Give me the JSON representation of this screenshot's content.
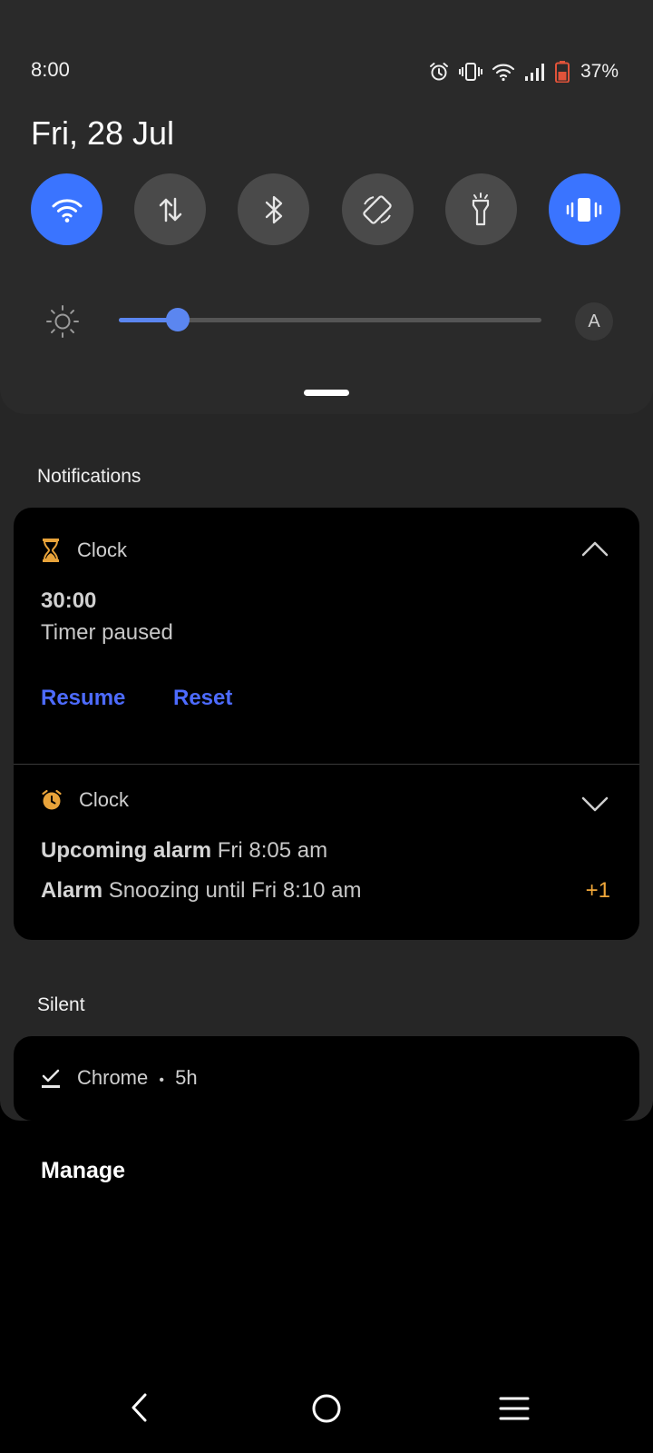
{
  "status_bar": {
    "time": "8:00",
    "battery": "37%",
    "icons": [
      "alarm-icon",
      "vibrate-icon",
      "wifi-icon",
      "signal-icon",
      "battery-icon"
    ]
  },
  "date": "Fri, 28 Jul",
  "quick_tiles": [
    {
      "name": "wifi",
      "icon": "wifi-icon",
      "active": true
    },
    {
      "name": "mobile-data",
      "icon": "data-arrows-icon",
      "active": false
    },
    {
      "name": "bluetooth",
      "icon": "bluetooth-icon",
      "active": false
    },
    {
      "name": "auto-rotate",
      "icon": "rotate-icon",
      "active": false
    },
    {
      "name": "flashlight",
      "icon": "flashlight-icon",
      "active": false
    },
    {
      "name": "vibrate",
      "icon": "vibrate-icon",
      "active": true
    }
  ],
  "brightness": {
    "level": 0.14,
    "auto_label": "A"
  },
  "sections": {
    "notifications": "Notifications",
    "silent": "Silent"
  },
  "timer_notification": {
    "app": "Clock",
    "title": "30:00",
    "text": "Timer paused",
    "actions": [
      "Resume",
      "Reset"
    ]
  },
  "alarm_notification": {
    "app": "Clock",
    "lines": [
      {
        "label": "Upcoming alarm",
        "text": "Fri 8:05 am"
      },
      {
        "label": "Alarm",
        "text": "Snoozing until Fri 8:10 am"
      }
    ],
    "more": "+1"
  },
  "silent_notification": {
    "app": "Chrome",
    "separator": "•",
    "time": "5h"
  },
  "manage_label": "Manage",
  "colors": {
    "accent": "#3a74ff",
    "action": "#4d6bff",
    "clock_icon": "#e8a33a",
    "battery_low": "#e0533a"
  }
}
